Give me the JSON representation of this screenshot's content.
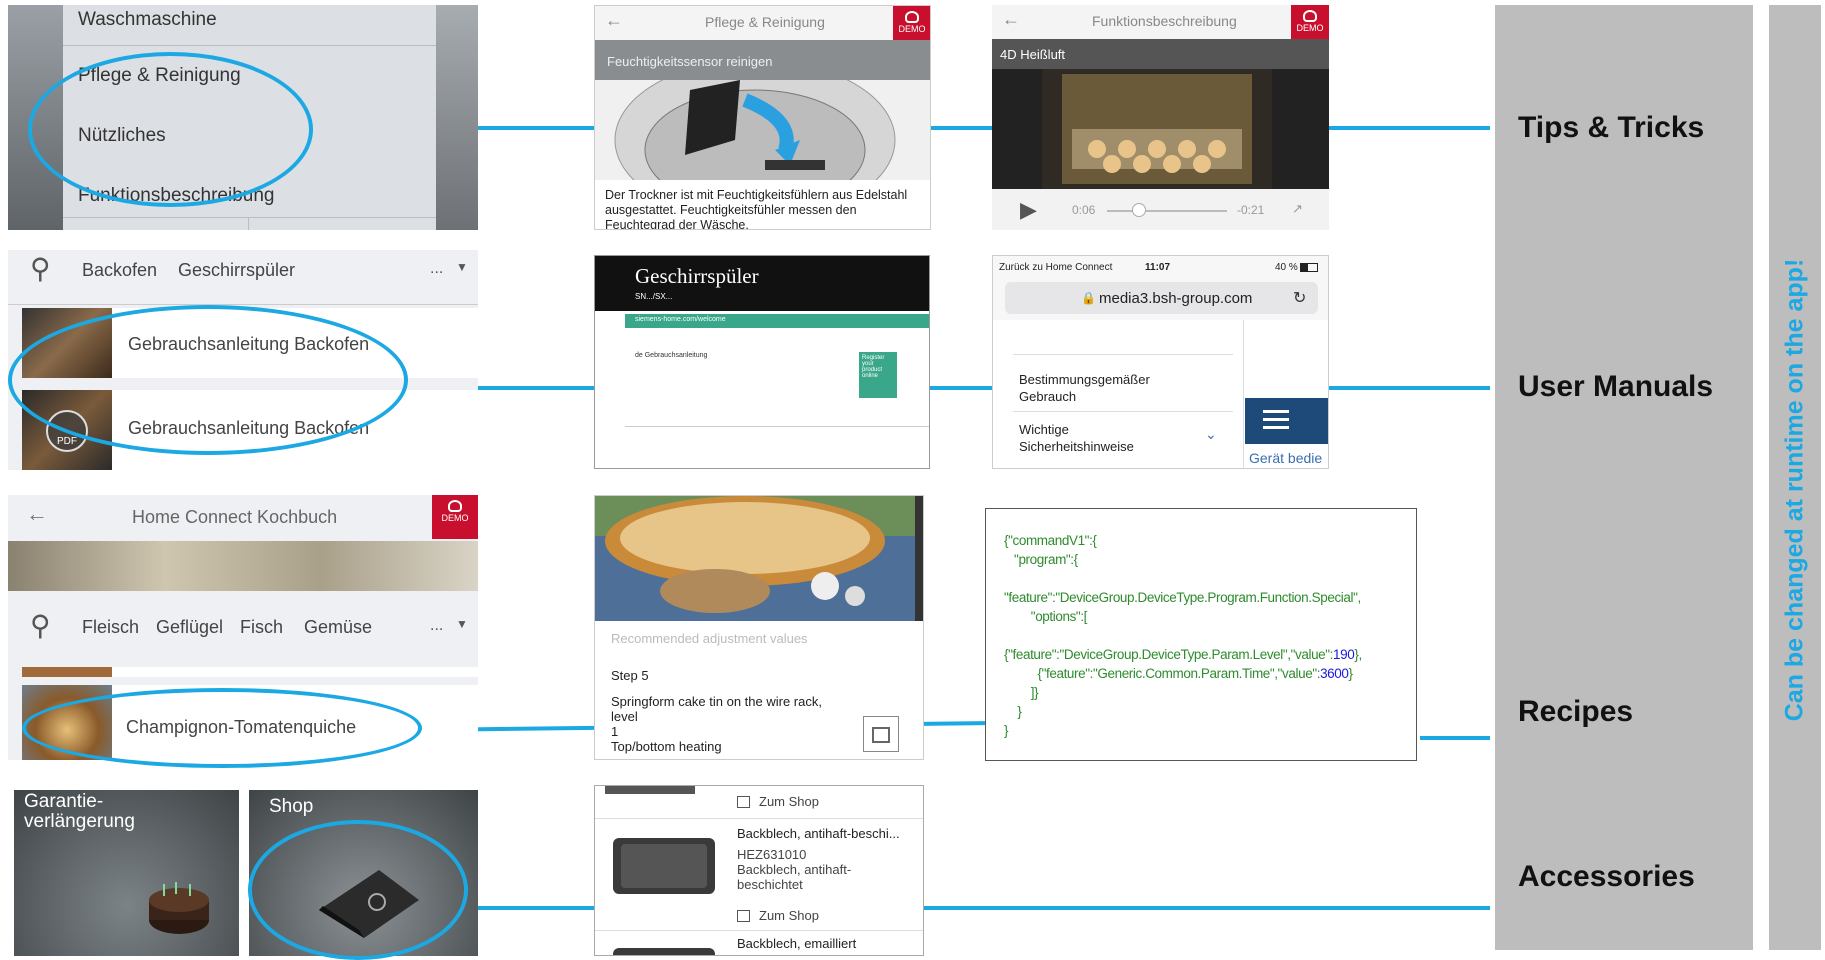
{
  "row1": {
    "menu_items": [
      "Waschmaschine",
      "Pflege & Reinigung",
      "Nützliches",
      "Funktionsbeschreibung"
    ],
    "care_screen": {
      "title": "Pflege & Reinigung",
      "banner": "Feuchtigkeitssensor reinigen",
      "body": "Der Trockner ist mit Feuchtigkeitsfühlern aus Edelstahl ausgestattet. Feuchtigkeitsfühler messen den Feuchtegrad der Wäsche.",
      "demo": "DEMO"
    },
    "function_screen": {
      "title": "Funktionsbeschreibung",
      "subtitle": "4D Heißluft",
      "time_elapsed": "0:06",
      "time_remaining": "-0:21",
      "demo": "DEMO"
    }
  },
  "row2": {
    "search_tabs": [
      "Backofen",
      "Geschirrspüler"
    ],
    "more": "...",
    "manual_items": [
      "Gebrauchsanleitung Backofen",
      "Gebrauchsanleitung Backofen"
    ],
    "pdf_label": "PDF",
    "dishwasher_doc": {
      "title": "Geschirrspüler",
      "model": "SN.../SX...",
      "url_bar": "siemens-home.com/welcome",
      "lang_line": "de  Gebrauchsanleitung",
      "register": "Register your product online"
    },
    "browser": {
      "back_label": "Zurück zu Home Connect",
      "time": "11:07",
      "battery": "40 %",
      "url": "media3.bsh-group.com",
      "menu_items": [
        "Bestimmungsgemäßer Gebrauch",
        "Wichtige Sicherheitshinweise"
      ],
      "side_link": "Gerät bedie"
    }
  },
  "row3": {
    "cookbook_title": "Home Connect Kochbuch",
    "categories": [
      "Fleisch",
      "Geflügel",
      "Fisch",
      "Gemüse"
    ],
    "more": "...",
    "recipe_item": "Champignon-Tomatenquiche",
    "demo": "DEMO",
    "recipe_screen": {
      "heading": "Recommended adjustment values",
      "step": "Step 5",
      "lines": [
        "Springform cake tin on the wire rack,",
        "level",
        "1",
        "Top/bottom heating"
      ]
    },
    "json_code": [
      {
        "parts": [
          {
            "t": "{\"commandV1\":{",
            "c": "g"
          }
        ]
      },
      {
        "parts": [
          {
            "t": "   \"program\":{",
            "c": "g"
          }
        ]
      },
      {
        "parts": []
      },
      {
        "parts": [
          {
            "t": "\"feature\":\"DeviceGroup.DeviceType.Program.Function.Special\",",
            "c": "g"
          }
        ]
      },
      {
        "parts": [
          {
            "t": "        \"options\":[",
            "c": "g"
          }
        ]
      },
      {
        "parts": []
      },
      {
        "parts": [
          {
            "t": "{\"feature\":\"DeviceGroup.DeviceType.Param.Level\",\"value\":",
            "c": "g"
          },
          {
            "t": "190",
            "c": "b"
          },
          {
            "t": "},",
            "c": "g"
          }
        ]
      },
      {
        "parts": [
          {
            "t": "          {\"feature\":\"Generic.Common.Param.Time\",\"value\":",
            "c": "g"
          },
          {
            "t": "3600",
            "c": "b"
          },
          {
            "t": "}",
            "c": "g"
          }
        ]
      },
      {
        "parts": [
          {
            "t": "        ]}",
            "c": "g"
          }
        ]
      },
      {
        "parts": [
          {
            "t": "    }",
            "c": "g"
          }
        ]
      },
      {
        "parts": [
          {
            "t": "}",
            "c": "g"
          }
        ]
      }
    ]
  },
  "row4": {
    "tile_warranty": "Garantie-\nverlängerung",
    "tile_shop": "Shop",
    "shop_list": {
      "zum_shop_1": "Zum Shop",
      "item1_title": "Backblech, antihaft-beschi...",
      "item1_code": "HEZ631010",
      "item1_desc": "Backblech, antihaft-\nbeschichtet",
      "zum_shop_2": "Zum Shop",
      "item2_title": "Backblech, emailliert"
    }
  },
  "categories": {
    "tips": "Tips & Tricks",
    "manuals": "User Manuals",
    "recipes": "Recipes",
    "accessories": "Accessories"
  },
  "side_note": "Can be changed at runtime on the app!",
  "colors": {
    "accent": "#1ca8e3",
    "demo_red": "#c8102e",
    "bar_gray": "#bdbdbd",
    "code_green": "#2e8b2e",
    "code_blue": "#1a1adf"
  }
}
